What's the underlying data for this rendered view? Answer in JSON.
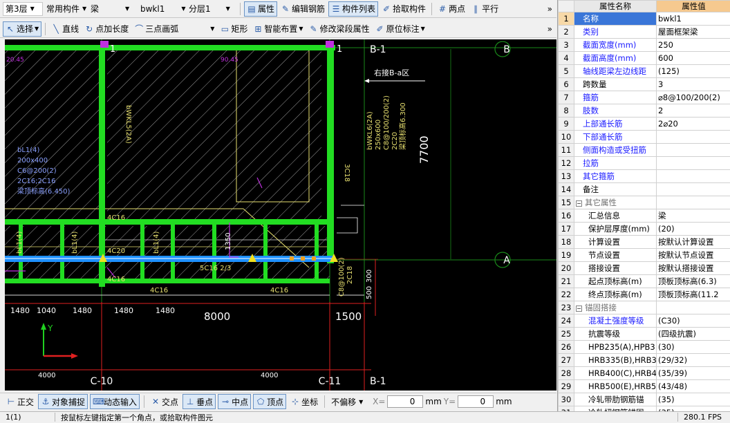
{
  "toolbar1": {
    "floor": "第3层",
    "category": "常用构件",
    "element_type": "梁",
    "element_name": "bwkl1",
    "layer": "分层1",
    "btn_properties": "属性",
    "btn_edit_rebar": "编辑钢筋",
    "btn_component_list": "构件列表",
    "btn_pick_component": "拾取构件",
    "btn_two_points": "两点",
    "btn_parallel": "平行"
  },
  "toolbar2": {
    "select": "选择",
    "line": "直线",
    "point_length": "点加长度",
    "three_point_arc": "三点画弧",
    "rectangle": "矩形",
    "smart_layout": "智能布置",
    "modify_beam_props": "修改梁段属性",
    "in_place_label": "原位标注"
  },
  "cad": {
    "axis_labels": [
      "C-10",
      "C-11",
      "B-1",
      "B",
      "A"
    ],
    "dims_bottom": [
      "1480",
      "1040",
      "1480",
      "1480",
      "1480"
    ],
    "dim_8000": "8000",
    "dim_1500": "1500",
    "dim_4000_left": "4000",
    "dim_4000_right": "4000",
    "dim_7700": "7700",
    "dim_1350": "1350",
    "dim_300": "300",
    "dim_500": "500",
    "arrow_text": "右接B-a区",
    "beam_labels": [
      "4C16",
      "4C16",
      "4C16",
      "4C20",
      "5C16 2/3",
      "4C16",
      "3C18",
      "C8@100(2)",
      "2C18"
    ],
    "beam_vertical_text": [
      "bWKL6(2A)",
      "250x600",
      "C8@100/200(2)",
      "2C20",
      "梁顶标高6.300",
      "bWKL5(2A)",
      "bL1(4)",
      "bL1(4)",
      "bL1(4)"
    ],
    "left_text": [
      "bL1(4)",
      "200x400",
      "C6@200(2)",
      "2C16;2C16",
      "梁顶标高(6.450)"
    ],
    "top_labels": [
      "20.45",
      "90.45",
      "1",
      "1"
    ]
  },
  "bottom_bar": {
    "ortho": "正交",
    "object_snap": "对象捕捉",
    "dynamic_input": "动态输入",
    "intersection": "交点",
    "perpendicular": "垂点",
    "midpoint": "中点",
    "vertex": "顶点",
    "coordinate": "坐标",
    "offset_mode": "不偏移",
    "x_label": "X=",
    "x_value": "0",
    "y_label": "Y=",
    "y_value": "0",
    "unit": "mm"
  },
  "status": {
    "left": "1(1)",
    "message": "按鼠标左键指定第一个角点，或拾取构件图元",
    "fps": "280.1 FPS"
  },
  "props": {
    "header_name": "属性名称",
    "header_value": "属性值",
    "rows": [
      {
        "n": "1",
        "k": "名称",
        "v": "bwkl1",
        "style": "sel"
      },
      {
        "n": "2",
        "k": "类别",
        "v": "屋面框架梁",
        "style": "blue"
      },
      {
        "n": "3",
        "k": "截面宽度(mm)",
        "v": "250",
        "style": "blue"
      },
      {
        "n": "4",
        "k": "截面高度(mm)",
        "v": "600",
        "style": "blue"
      },
      {
        "n": "5",
        "k": "轴线距梁左边线距",
        "v": "(125)",
        "style": "blue"
      },
      {
        "n": "6",
        "k": "跨数量",
        "v": "3",
        "style": ""
      },
      {
        "n": "7",
        "k": "箍筋",
        "v": "⌀8@100/200(2)",
        "style": "blue"
      },
      {
        "n": "8",
        "k": "肢数",
        "v": "2",
        "style": "blue"
      },
      {
        "n": "9",
        "k": "上部通长筋",
        "v": "2⌀20",
        "style": "blue"
      },
      {
        "n": "10",
        "k": "下部通长筋",
        "v": "",
        "style": "blue"
      },
      {
        "n": "11",
        "k": "侧面构造或受扭筋",
        "v": "",
        "style": "blue"
      },
      {
        "n": "12",
        "k": "拉筋",
        "v": "",
        "style": "blue"
      },
      {
        "n": "13",
        "k": "其它箍筋",
        "v": "",
        "style": "blue"
      },
      {
        "n": "14",
        "k": "备注",
        "v": "",
        "style": ""
      },
      {
        "n": "15",
        "k": "其它属性",
        "v": "",
        "style": "group"
      },
      {
        "n": "16",
        "k": "汇总信息",
        "v": "梁",
        "style": "ind"
      },
      {
        "n": "17",
        "k": "保护层厚度(mm)",
        "v": "(20)",
        "style": "ind"
      },
      {
        "n": "18",
        "k": "计算设置",
        "v": "按默认计算设置",
        "style": "ind"
      },
      {
        "n": "19",
        "k": "节点设置",
        "v": "按默认节点设置",
        "style": "ind"
      },
      {
        "n": "20",
        "k": "搭接设置",
        "v": "按默认搭接设置",
        "style": "ind"
      },
      {
        "n": "21",
        "k": "起点顶标高(m)",
        "v": "顶板顶标高(6.3)",
        "style": "ind"
      },
      {
        "n": "22",
        "k": "终点顶标高(m)",
        "v": "顶板顶标高(11.2",
        "style": "ind"
      },
      {
        "n": "23",
        "k": "锚固搭接",
        "v": "",
        "style": "group"
      },
      {
        "n": "24",
        "k": "混凝土强度等级",
        "v": "(C30)",
        "style": "indblue"
      },
      {
        "n": "25",
        "k": "抗震等级",
        "v": "(四级抗震)",
        "style": "ind"
      },
      {
        "n": "26",
        "k": "HPB235(A),HPB3",
        "v": "(30)",
        "style": "ind"
      },
      {
        "n": "27",
        "k": "HRB335(B),HRB3",
        "v": "(29/32)",
        "style": "ind"
      },
      {
        "n": "28",
        "k": "HRB400(C),HRB4",
        "v": "(35/39)",
        "style": "ind"
      },
      {
        "n": "29",
        "k": "HRB500(E),HRB5",
        "v": "(43/48)",
        "style": "ind"
      },
      {
        "n": "30",
        "k": "冷轧带肋钢筋锚",
        "v": "(35)",
        "style": "ind"
      },
      {
        "n": "31",
        "k": "冷轧扭钢筋锚固",
        "v": "(35)",
        "style": "ind"
      }
    ]
  },
  "colors": {
    "beam_green": "#22dd22",
    "axis_red": "#e02020",
    "text_yellow": "#e8e070",
    "magenta": "#c030e0",
    "blue_beam": "#1e90ff"
  }
}
